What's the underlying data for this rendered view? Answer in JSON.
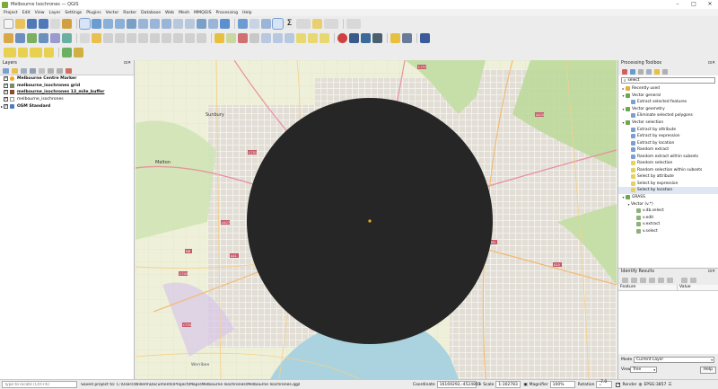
{
  "window": {
    "title": "Melbourne Isochrones — QGIS",
    "controls": [
      "–",
      "□",
      "✕"
    ]
  },
  "menu": [
    "Project",
    "Edit",
    "View",
    "Layer",
    "Settings",
    "Plugins",
    "Vector",
    "Raster",
    "Database",
    "Web",
    "Mesh",
    "MMQGIS",
    "Processing",
    "Help"
  ],
  "layers_panel": {
    "title": "Layers",
    "items": [
      {
        "label": "Melbourne Centre Marker",
        "color": "#f5a623",
        "bold": true
      },
      {
        "label": "melbourne_isochrones grid",
        "color": "#7a8b6a",
        "bold": true
      },
      {
        "label": "melbourne_isochrones 13_mile_buffer",
        "color": "#8b4a2b",
        "bold": true
      },
      {
        "label": "melbourne_isochrones",
        "color": "#999999",
        "bold": false
      },
      {
        "label": "OSM Standard",
        "color": "#4a7fbf",
        "bold": true
      }
    ]
  },
  "toolbox": {
    "title": "Processing Toolbox",
    "search_value": "select",
    "tree": [
      {
        "label": "Recently used",
        "level": 0,
        "arrow": "▸",
        "color": "#e0b040"
      },
      {
        "label": "Vector general",
        "level": 0,
        "arrow": "▾",
        "color": "#6aa84f"
      },
      {
        "label": "Extract selected features",
        "level": 1,
        "arrow": "",
        "color": "#7a9fd0"
      },
      {
        "label": "Vector geometry",
        "level": 0,
        "arrow": "▾",
        "color": "#6aa84f"
      },
      {
        "label": "Eliminate selected polygons",
        "level": 1,
        "arrow": "",
        "color": "#7a9fd0"
      },
      {
        "label": "Vector selection",
        "level": 0,
        "arrow": "▾",
        "color": "#6aa84f"
      },
      {
        "label": "Extract by attribute",
        "level": 1,
        "arrow": "",
        "color": "#7a9fd0"
      },
      {
        "label": "Extract by expression",
        "level": 1,
        "arrow": "",
        "color": "#7a9fd0"
      },
      {
        "label": "Extract by location",
        "level": 1,
        "arrow": "",
        "color": "#7a9fd0"
      },
      {
        "label": "Random extract",
        "level": 1,
        "arrow": "",
        "color": "#7a9fd0"
      },
      {
        "label": "Random extract within subsets",
        "level": 1,
        "arrow": "",
        "color": "#7a9fd0"
      },
      {
        "label": "Random selection",
        "level": 1,
        "arrow": "",
        "color": "#e8d060"
      },
      {
        "label": "Random selection within subsets",
        "level": 1,
        "arrow": "",
        "color": "#e8d060"
      },
      {
        "label": "Select by attribute",
        "level": 1,
        "arrow": "",
        "color": "#e8d060"
      },
      {
        "label": "Select by expression",
        "level": 1,
        "arrow": "",
        "color": "#e8d060"
      },
      {
        "label": "Select by location",
        "level": 1,
        "arrow": "",
        "color": "#e8d060",
        "selected": true
      },
      {
        "label": "GRASS",
        "level": 0,
        "arrow": "▾",
        "color": "#6aa84f"
      },
      {
        "label": "Vector (v.*)",
        "level": 1,
        "arrow": "▾",
        "color": ""
      },
      {
        "label": "v.db.select",
        "level": 2,
        "arrow": "",
        "color": "#8fb07a"
      },
      {
        "label": "v.edit",
        "level": 2,
        "arrow": "",
        "color": "#8fb07a"
      },
      {
        "label": "v.extract",
        "level": 2,
        "arrow": "",
        "color": "#8fb07a"
      },
      {
        "label": "v.select",
        "level": 2,
        "arrow": "",
        "color": "#8fb07a"
      }
    ]
  },
  "identify": {
    "title": "Identify Results",
    "col_feature": "Feature",
    "col_value": "Value",
    "mode_label": "Mode",
    "mode_value": "Current Layer",
    "view_label": "View",
    "view_value": "Tree",
    "help_label": "Help"
  },
  "map": {
    "buffer_color": "#262626",
    "marker_color": "#f5a623",
    "bay_color": "#aad3df",
    "labels": {
      "sunbury": "Sunbury",
      "melton": "Melton",
      "road_c737": "C737",
      "road_a420": "A420",
      "road_c751": "C751",
      "road_a427": "A427",
      "road_a41": "A41",
      "road_m8": "M8",
      "road_m1": "M1",
      "road_a10": "A10",
      "road_c743": "C743",
      "road_c755": "C755",
      "werribee": "Werribee"
    }
  },
  "statusbar": {
    "locator_placeholder": "Type to locate (Ctrl+K)",
    "saved_message": "Saved project to: C:\\Users\\Willem\\Documents\\Project\\Maps\\Melbourne Isochrones\\Melbourne Isochrones.qgz",
    "coordinate_label": "Coordinate",
    "coordinate_value": "16169292,-4524897",
    "scale_label": "Scale",
    "scale_value": "1:302783",
    "magnifier_label": "Magnifier",
    "magnifier_value": "100%",
    "rotation_label": "Rotation",
    "rotation_value": "-7.0 °",
    "render_label": "Render",
    "crs_label": "EPSG:3857"
  }
}
